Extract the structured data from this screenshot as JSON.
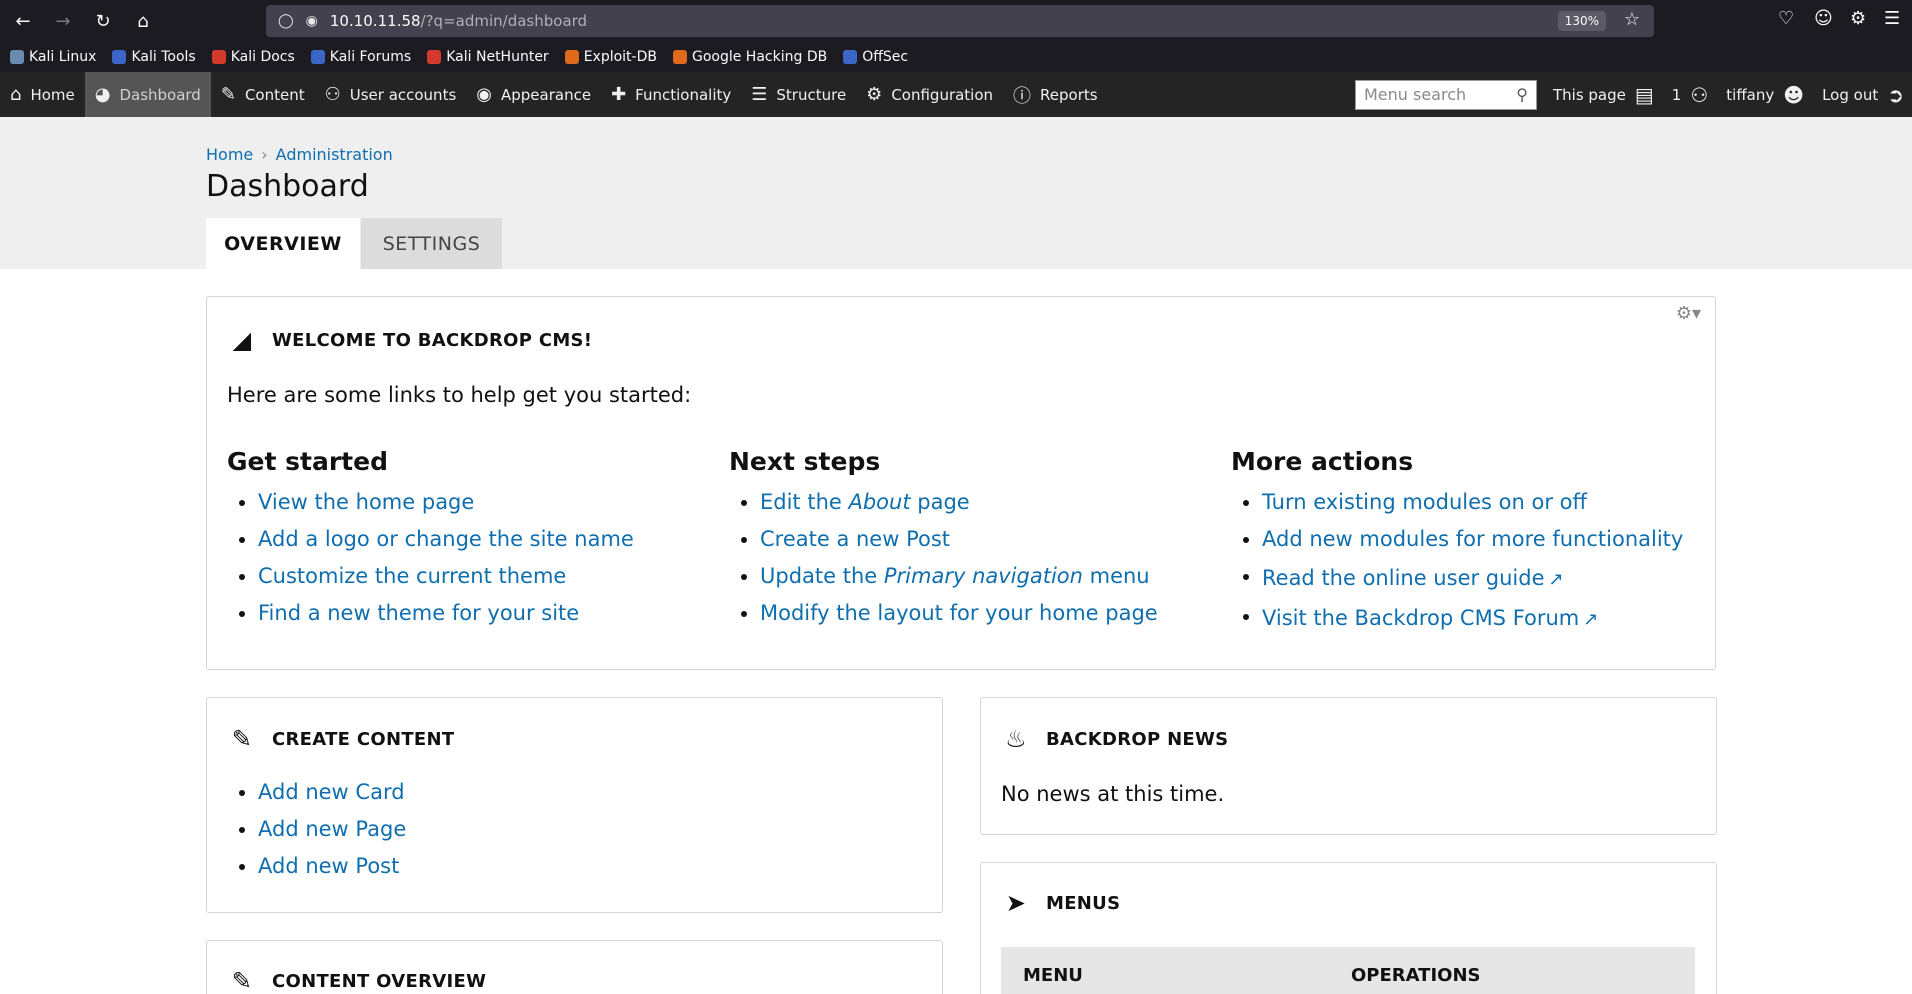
{
  "browser": {
    "url_host": "10.10.11.58",
    "url_path": "/?q=admin/dashboard",
    "zoom": "130%"
  },
  "bookmarks": [
    {
      "label": "Kali Linux",
      "color": "#6a8bb0"
    },
    {
      "label": "Kali Tools",
      "color": "#3b66c8"
    },
    {
      "label": "Kali Docs",
      "color": "#d33a2c"
    },
    {
      "label": "Kali Forums",
      "color": "#3b66c8"
    },
    {
      "label": "Kali NetHunter",
      "color": "#d33a2c"
    },
    {
      "label": "Exploit-DB",
      "color": "#e06a1b"
    },
    {
      "label": "Google Hacking DB",
      "color": "#e06a1b"
    },
    {
      "label": "OffSec",
      "color": "#3b66c8"
    }
  ],
  "admin_menu": {
    "items": [
      "Home",
      "Dashboard",
      "Content",
      "User accounts",
      "Appearance",
      "Functionality",
      "Structure",
      "Configuration",
      "Reports"
    ],
    "search_placeholder": "Menu search",
    "this_page": "This page",
    "user_count": "1",
    "username": "tiffany",
    "logout": "Log out"
  },
  "breadcrumb": [
    "Home",
    "Administration"
  ],
  "page_title": "Dashboard",
  "tabs": [
    "OVERVIEW",
    "SETTINGS"
  ],
  "welcome": {
    "title": "WELCOME TO BACKDROP CMS!",
    "intro": "Here are some links to help get you started:",
    "get_started": {
      "heading": "Get started",
      "links": [
        "View the home page",
        "Add a logo or change the site name",
        "Customize the current theme",
        "Find a new theme for your site"
      ]
    },
    "next_steps": {
      "heading": "Next steps",
      "l1_a": "Edit the ",
      "l1_em": "About",
      "l1_b": " page",
      "l2": "Create a new Post",
      "l3_a": "Update the ",
      "l3_em": "Primary navigation",
      "l3_b": " menu",
      "l4": "Modify the layout for your home page"
    },
    "more_actions": {
      "heading": "More actions",
      "links": [
        "Turn existing modules on or off",
        "Add new modules for more functionality",
        "Read the online user guide",
        "Visit the Backdrop CMS Forum"
      ]
    }
  },
  "create_content": {
    "title": "CREATE CONTENT",
    "links": [
      "Add new Card",
      "Add new Page",
      "Add new Post"
    ]
  },
  "news": {
    "title": "BACKDROP NEWS",
    "text": "No news at this time."
  },
  "menus": {
    "title": "MENUS",
    "col_menu": "MENU",
    "col_ops": "OPERATIONS"
  },
  "content_overview": {
    "title": "CONTENT OVERVIEW"
  }
}
